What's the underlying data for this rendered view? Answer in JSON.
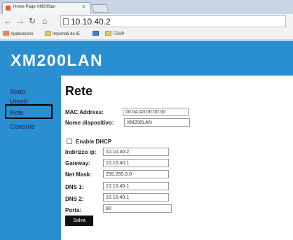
{
  "browser": {
    "tab_title": "Home Page XM200lan",
    "tab_close": "×",
    "url": "10.10.40.2",
    "bookmarks": [
      {
        "icon": "apps-icon",
        "label": "Applicazioni"
      },
      {
        "icon": "folder-icon",
        "label": "Importati da IE"
      },
      {
        "icon": "blue-square-icon",
        "label": ""
      },
      {
        "icon": "folder-icon",
        "label": "TEMP"
      }
    ]
  },
  "site": {
    "title": "XM200LAN"
  },
  "sidebar": {
    "items": [
      {
        "label": "Stato"
      },
      {
        "label": "Utenti"
      },
      {
        "label": "Rete"
      },
      {
        "label": "Console"
      }
    ]
  },
  "main": {
    "title": "Rete",
    "mac_label": "MAC Address:",
    "mac_value": "00:04:A3:00:00:00",
    "device_label": "Nome dispositivo:",
    "device_value": "XM200LAN",
    "dhcp_label": "Enable DHCP",
    "ip_label": "Indirizzo ip:",
    "ip_value": "10.10.40.2",
    "gateway_label": "Gateway:",
    "gateway_value": "10.10.40.1",
    "netmask_label": "Net Mask:",
    "netmask_value": "255.255.0.0",
    "dns1_label": "DNS 1:",
    "dns1_value": "10.10.40.1",
    "dns2_label": "DNS 2:",
    "dns2_value": "10.10.40.1",
    "port_label": "Porta:",
    "port_value": "80",
    "save_label": "Salva"
  },
  "colors": {
    "brand_blue": "#2a8fd0",
    "sidebar_text": "#1f3a7a"
  }
}
